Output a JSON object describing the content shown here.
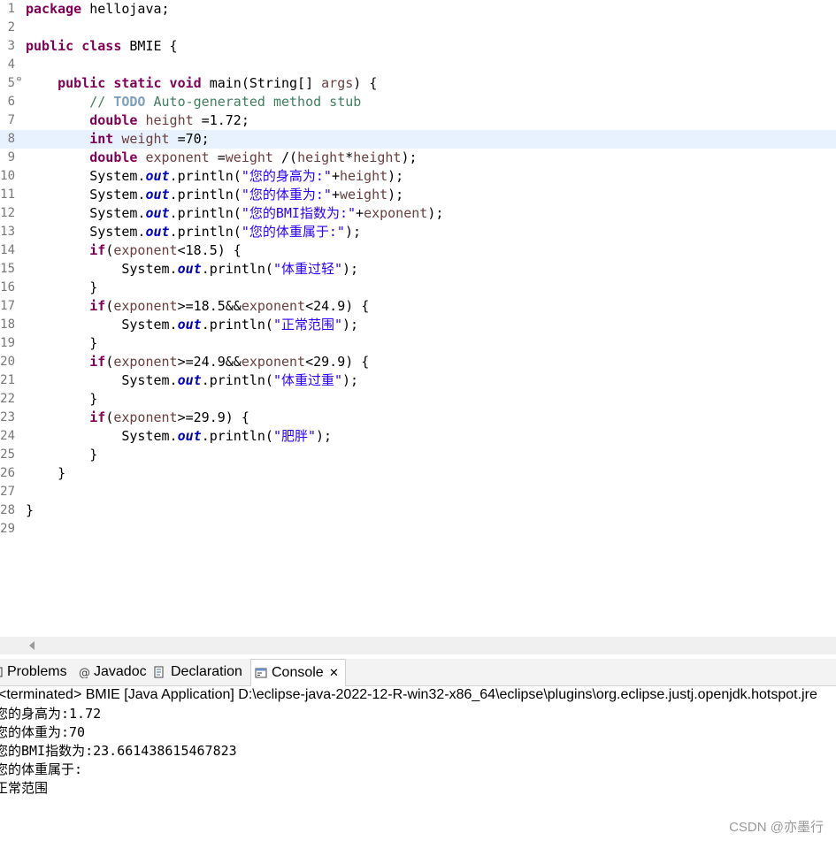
{
  "editor": {
    "current_line": 8,
    "lines": [
      {
        "n": "1",
        "tokens": [
          {
            "t": "package",
            "c": "kw"
          },
          {
            "t": " hellojava;",
            "c": "plain"
          }
        ]
      },
      {
        "n": "2",
        "tokens": []
      },
      {
        "n": "3",
        "tokens": [
          {
            "t": "public class",
            "c": "kw"
          },
          {
            "t": " BMIE {",
            "c": "plain"
          }
        ]
      },
      {
        "n": "4",
        "tokens": []
      },
      {
        "n": "5",
        "fold": true,
        "tokens": [
          {
            "t": "    ",
            "c": "plain"
          },
          {
            "t": "public static void",
            "c": "kw"
          },
          {
            "t": " main(String[] ",
            "c": "plain"
          },
          {
            "t": "args",
            "c": "var"
          },
          {
            "t": ") {",
            "c": "plain"
          }
        ]
      },
      {
        "n": "6",
        "tokens": [
          {
            "t": "        // ",
            "c": "cmt"
          },
          {
            "t": "TODO",
            "c": "todo"
          },
          {
            "t": " Auto-generated method stub",
            "c": "cmt"
          }
        ]
      },
      {
        "n": "7",
        "tokens": [
          {
            "t": "        ",
            "c": "plain"
          },
          {
            "t": "double",
            "c": "kw"
          },
          {
            "t": " ",
            "c": "plain"
          },
          {
            "t": "height",
            "c": "var"
          },
          {
            "t": " =1.72;",
            "c": "plain"
          }
        ]
      },
      {
        "n": "8",
        "tokens": [
          {
            "t": "        ",
            "c": "plain"
          },
          {
            "t": "int",
            "c": "kw"
          },
          {
            "t": " ",
            "c": "plain"
          },
          {
            "t": "weight",
            "c": "var"
          },
          {
            "t": " =70;",
            "c": "plain"
          }
        ]
      },
      {
        "n": "9",
        "tokens": [
          {
            "t": "        ",
            "c": "plain"
          },
          {
            "t": "double",
            "c": "kw"
          },
          {
            "t": " ",
            "c": "plain"
          },
          {
            "t": "exponent",
            "c": "var"
          },
          {
            "t": " =",
            "c": "plain"
          },
          {
            "t": "weight",
            "c": "var"
          },
          {
            "t": " /(",
            "c": "plain"
          },
          {
            "t": "height",
            "c": "var"
          },
          {
            "t": "*",
            "c": "plain"
          },
          {
            "t": "height",
            "c": "var"
          },
          {
            "t": ");",
            "c": "plain"
          }
        ]
      },
      {
        "n": "10",
        "tokens": [
          {
            "t": "        System.",
            "c": "plain"
          },
          {
            "t": "out",
            "c": "field"
          },
          {
            "t": ".println(",
            "c": "plain"
          },
          {
            "t": "\"您的身高为:\"",
            "c": "str"
          },
          {
            "t": "+",
            "c": "plain"
          },
          {
            "t": "height",
            "c": "var"
          },
          {
            "t": ");",
            "c": "plain"
          }
        ]
      },
      {
        "n": "11",
        "tokens": [
          {
            "t": "        System.",
            "c": "plain"
          },
          {
            "t": "out",
            "c": "field"
          },
          {
            "t": ".println(",
            "c": "plain"
          },
          {
            "t": "\"您的体重为:\"",
            "c": "str"
          },
          {
            "t": "+",
            "c": "plain"
          },
          {
            "t": "weight",
            "c": "var"
          },
          {
            "t": ");",
            "c": "plain"
          }
        ]
      },
      {
        "n": "12",
        "tokens": [
          {
            "t": "        System.",
            "c": "plain"
          },
          {
            "t": "out",
            "c": "field"
          },
          {
            "t": ".println(",
            "c": "plain"
          },
          {
            "t": "\"您的BMI指数为:\"",
            "c": "str"
          },
          {
            "t": "+",
            "c": "plain"
          },
          {
            "t": "exponent",
            "c": "var"
          },
          {
            "t": ");",
            "c": "plain"
          }
        ]
      },
      {
        "n": "13",
        "tokens": [
          {
            "t": "        System.",
            "c": "plain"
          },
          {
            "t": "out",
            "c": "field"
          },
          {
            "t": ".println(",
            "c": "plain"
          },
          {
            "t": "\"您的体重属于:\"",
            "c": "str"
          },
          {
            "t": ");",
            "c": "plain"
          }
        ]
      },
      {
        "n": "14",
        "tokens": [
          {
            "t": "        ",
            "c": "plain"
          },
          {
            "t": "if",
            "c": "kw"
          },
          {
            "t": "(",
            "c": "plain"
          },
          {
            "t": "exponent",
            "c": "var"
          },
          {
            "t": "<18.5) {",
            "c": "plain"
          }
        ]
      },
      {
        "n": "15",
        "tokens": [
          {
            "t": "            System.",
            "c": "plain"
          },
          {
            "t": "out",
            "c": "field"
          },
          {
            "t": ".println(",
            "c": "plain"
          },
          {
            "t": "\"体重过轻\"",
            "c": "str"
          },
          {
            "t": ");",
            "c": "plain"
          }
        ]
      },
      {
        "n": "16",
        "tokens": [
          {
            "t": "        }",
            "c": "plain"
          }
        ]
      },
      {
        "n": "17",
        "tokens": [
          {
            "t": "        ",
            "c": "plain"
          },
          {
            "t": "if",
            "c": "kw"
          },
          {
            "t": "(",
            "c": "plain"
          },
          {
            "t": "exponent",
            "c": "var"
          },
          {
            "t": ">=18.5&&",
            "c": "plain"
          },
          {
            "t": "exponent",
            "c": "var"
          },
          {
            "t": "<24.9) {",
            "c": "plain"
          }
        ]
      },
      {
        "n": "18",
        "tokens": [
          {
            "t": "            System.",
            "c": "plain"
          },
          {
            "t": "out",
            "c": "field"
          },
          {
            "t": ".println(",
            "c": "plain"
          },
          {
            "t": "\"正常范围\"",
            "c": "str"
          },
          {
            "t": ");",
            "c": "plain"
          }
        ]
      },
      {
        "n": "19",
        "tokens": [
          {
            "t": "        }",
            "c": "plain"
          }
        ]
      },
      {
        "n": "20",
        "tokens": [
          {
            "t": "        ",
            "c": "plain"
          },
          {
            "t": "if",
            "c": "kw"
          },
          {
            "t": "(",
            "c": "plain"
          },
          {
            "t": "exponent",
            "c": "var"
          },
          {
            "t": ">=24.9&&",
            "c": "plain"
          },
          {
            "t": "exponent",
            "c": "var"
          },
          {
            "t": "<29.9) {",
            "c": "plain"
          }
        ]
      },
      {
        "n": "21",
        "tokens": [
          {
            "t": "            System.",
            "c": "plain"
          },
          {
            "t": "out",
            "c": "field"
          },
          {
            "t": ".println(",
            "c": "plain"
          },
          {
            "t": "\"体重过重\"",
            "c": "str"
          },
          {
            "t": ");",
            "c": "plain"
          }
        ]
      },
      {
        "n": "22",
        "tokens": [
          {
            "t": "        }",
            "c": "plain"
          }
        ]
      },
      {
        "n": "23",
        "tokens": [
          {
            "t": "        ",
            "c": "plain"
          },
          {
            "t": "if",
            "c": "kw"
          },
          {
            "t": "(",
            "c": "plain"
          },
          {
            "t": "exponent",
            "c": "var"
          },
          {
            "t": ">=29.9) {",
            "c": "plain"
          }
        ]
      },
      {
        "n": "24",
        "tokens": [
          {
            "t": "            System.",
            "c": "plain"
          },
          {
            "t": "out",
            "c": "field"
          },
          {
            "t": ".println(",
            "c": "plain"
          },
          {
            "t": "\"肥胖\"",
            "c": "str"
          },
          {
            "t": ");",
            "c": "plain"
          }
        ]
      },
      {
        "n": "25",
        "tokens": [
          {
            "t": "        }",
            "c": "plain"
          }
        ]
      },
      {
        "n": "26",
        "tokens": [
          {
            "t": "    }",
            "c": "plain"
          }
        ]
      },
      {
        "n": "27",
        "tokens": []
      },
      {
        "n": "28",
        "tokens": [
          {
            "t": "}",
            "c": "plain"
          }
        ]
      },
      {
        "n": "29",
        "tokens": []
      }
    ]
  },
  "tabs": {
    "problems": "Problems",
    "javadoc": "Javadoc",
    "declaration": "Declaration",
    "console": "Console",
    "close_glyph": "✕"
  },
  "console": {
    "header": "<terminated> BMIE [Java Application] D:\\eclipse-java-2022-12-R-win32-x86_64\\eclipse\\plugins\\org.eclipse.justj.openjdk.hotspot.jre",
    "output": [
      "您的身高为:1.72",
      "您的体重为:70",
      "您的BMI指数为:23.661438615467823",
      "您的体重属于:",
      "正常范围"
    ]
  },
  "watermark": "CSDN @亦墨行",
  "icons": [
    "fold-collapse-icon",
    "scroll-left-arrow-icon",
    "problems-icon",
    "javadoc-icon",
    "declaration-icon",
    "console-icon",
    "close-icon"
  ],
  "colors": {
    "keyword": "#7f0055",
    "string": "#2a00ff",
    "local_variable": "#6a3e3e",
    "static_field": "#0000c0",
    "comment": "#3f7f5f",
    "todo_tag": "#7f9fbf",
    "current_line": "#e8f2fe"
  }
}
